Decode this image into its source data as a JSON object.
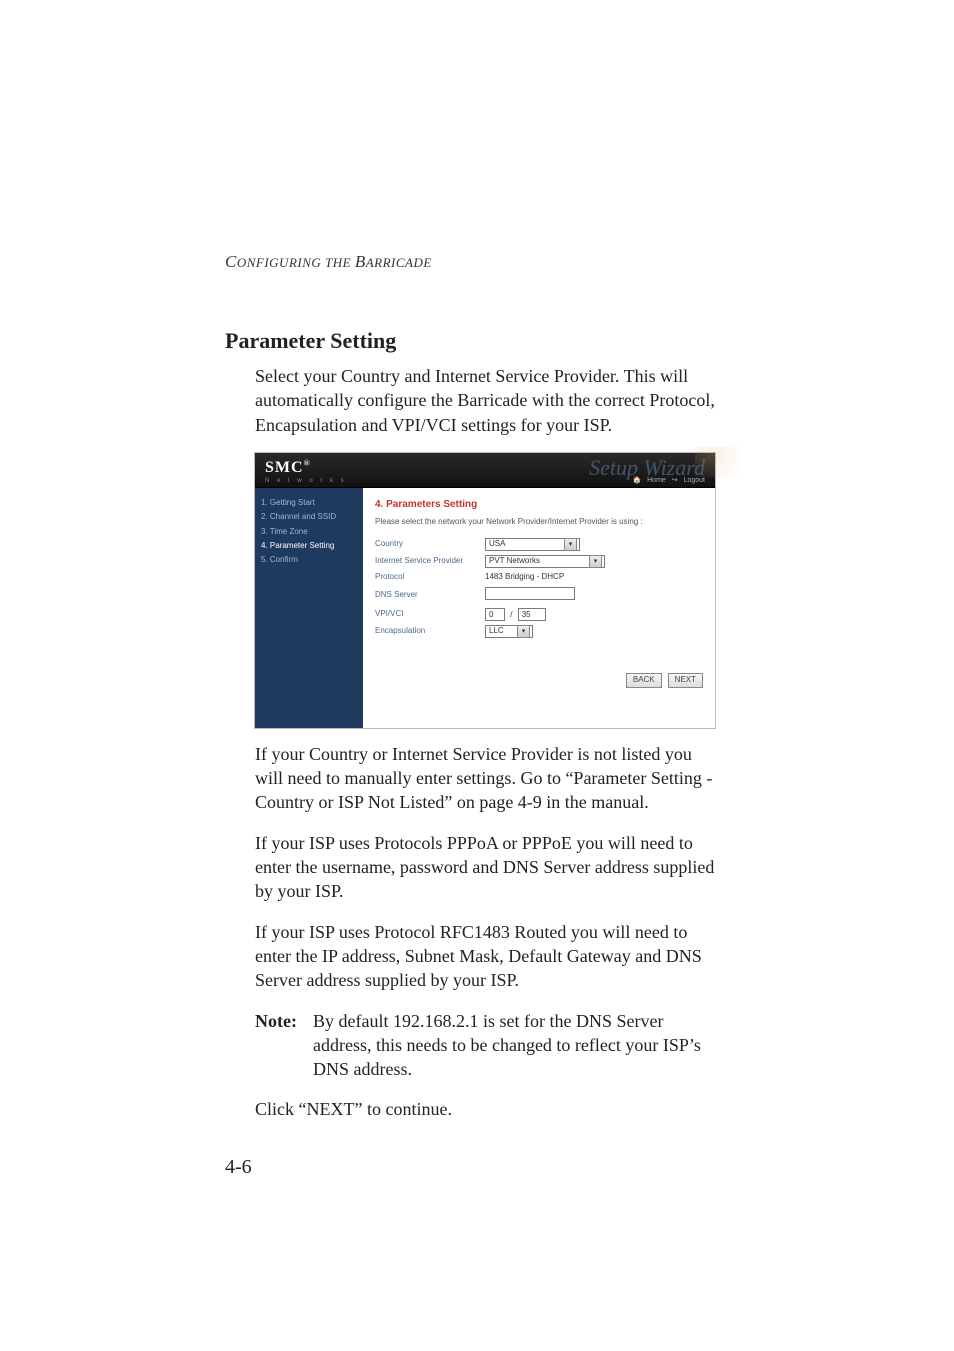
{
  "running_head": "Configuring the Barricade",
  "section_title": "Parameter Setting",
  "intro_paragraph": "Select your Country and Internet Service Provider. This will automatically configure the Barricade with the correct Protocol, Encapsulation and VPI/VCI settings for your ISP.",
  "router": {
    "logo": "SMC",
    "logo_sub": "N e t w o r k s",
    "top_title": "Setup Wizard",
    "top_links": {
      "home": "Home",
      "logout": "Logout"
    },
    "nav": {
      "items": [
        "1. Getting Start",
        "2. Channel and SSID",
        "3. Time Zone",
        "4. Parameter Setting",
        "5. Confirm"
      ],
      "active_index": 3
    },
    "panel_title": "4. Parameters Setting",
    "panel_hint": "Please select the network your Network Provider/Internet Provider is using :",
    "fields": {
      "country": {
        "label": "Country",
        "value": "USA"
      },
      "isp": {
        "label": "Internet Service Provider",
        "value": "PVT Networks"
      },
      "protocol": {
        "label": "Protocol",
        "value": "1483 Bridging - DHCP"
      },
      "dns": {
        "label": "DNS Server",
        "value": ""
      },
      "vpivci": {
        "label": "VPI/VCI",
        "vpi": "0",
        "vci": "35"
      },
      "encap": {
        "label": "Encapsulation",
        "value": "LLC"
      }
    },
    "buttons": {
      "back": "BACK",
      "next": "NEXT"
    }
  },
  "after_shot_p1": "If your Country or Internet Service Provider is not listed you will need to manually enter settings. Go to “Parameter Setting - Country or ISP Not Listed” on page 4-9 in the manual.",
  "after_shot_p2": "If your ISP uses Protocols PPPoA or PPPoE you will need to enter the username, password and DNS Server address supplied by your ISP.",
  "after_shot_p3": "If your ISP uses Protocol RFC1483 Routed you will need to enter the IP address, Subnet Mask, Default Gateway and DNS Server address supplied by your ISP.",
  "note_label": "Note:",
  "note_text": "By default 192.168.2.1 is set for the DNS Server address, this needs to be changed to reflect your ISP’s DNS address.",
  "click_next": "Click “NEXT” to continue.",
  "page_number": "4-6"
}
